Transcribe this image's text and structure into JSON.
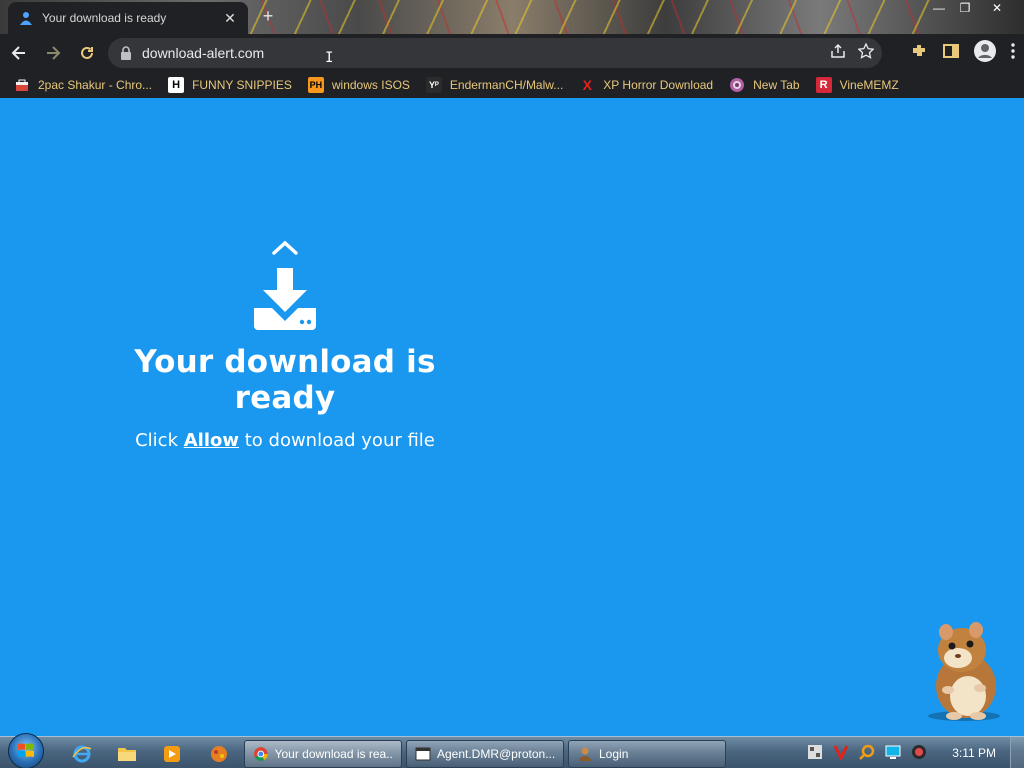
{
  "browser": {
    "tab": {
      "title": "Your download is ready",
      "close": "✕"
    },
    "new_tab": "+",
    "window_controls": {
      "minimize": "—",
      "restore": "❐",
      "close": "✕"
    },
    "url": "download-alert.com"
  },
  "bookmarks": [
    {
      "label": "2pac Shakur - Chro...",
      "icon": "bag-icon",
      "glyph": "",
      "color": "#d9463b"
    },
    {
      "label": "FUNNY SNIPPIES",
      "icon": "h-logo-icon",
      "glyph": "H",
      "color": "#ffffff"
    },
    {
      "label": "windows ISOS",
      "icon": "ph-logo-icon",
      "glyph": "PH",
      "color": "#f7971d"
    },
    {
      "label": "EndermanCH/Malw...",
      "icon": "yp-logo-icon",
      "glyph": "Yᴾ",
      "color": "#2b2b2b"
    },
    {
      "label": "XP Horror Download",
      "icon": "x-logo-icon",
      "glyph": "X",
      "color": "#e0231a"
    },
    {
      "label": "New Tab",
      "icon": "globe-icon",
      "glyph": "",
      "color": "#b05fa3"
    },
    {
      "label": "VineMEMZ",
      "icon": "r-logo-icon",
      "glyph": "R",
      "color": "#d5283a"
    }
  ],
  "page": {
    "background": "#1a98ef",
    "headline": "Your download is ready",
    "sub_before": "Click ",
    "sub_allow": "Allow",
    "sub_after": " to download your file"
  },
  "taskbar": {
    "quick_launch": [
      "ie-icon",
      "folder-icon",
      "media-player-icon",
      "game-icon"
    ],
    "tasks": [
      {
        "label": "Your download is rea...",
        "icon": "chrome-icon",
        "active": true
      },
      {
        "label": "Agent.DMR@proton...",
        "icon": "window-icon",
        "active": false
      },
      {
        "label": "Login",
        "icon": "user-icon",
        "active": false
      }
    ],
    "clock": "3:11 PM"
  }
}
